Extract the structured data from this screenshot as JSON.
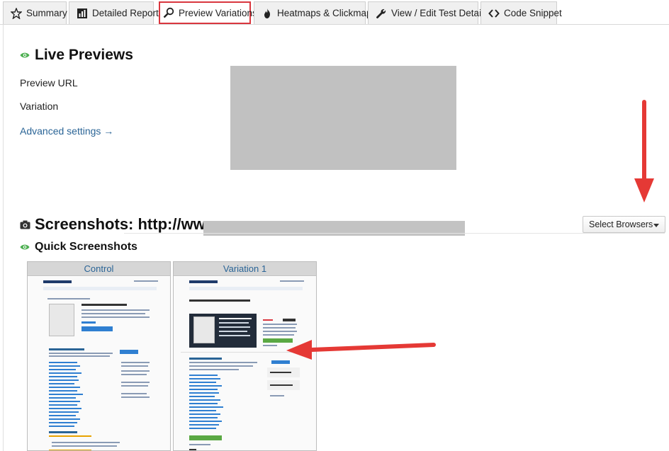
{
  "tabs": [
    {
      "label": "Summary",
      "icon": "star-icon",
      "active": false
    },
    {
      "label": "Detailed Report",
      "icon": "bar-chart-icon",
      "active": false
    },
    {
      "label": "Preview Variations",
      "icon": "magnifier-icon",
      "active": true
    },
    {
      "label": "Heatmaps & Clickmaps",
      "icon": "fire-icon",
      "active": false
    },
    {
      "label": "View / Edit Test Details",
      "icon": "wrench-icon",
      "active": false
    },
    {
      "label": "Code Snippet",
      "icon": "code-icon",
      "active": false
    }
  ],
  "live_previews": {
    "title": "Live Previews",
    "preview_url_label": "Preview URL",
    "variation_label": "Variation",
    "advanced_link": "Advanced settings →"
  },
  "screenshots": {
    "title": "Screenshots: http://www.",
    "quick_title": "Quick Screenshots",
    "select_browsers_label": "Select Browsers",
    "cards": [
      {
        "label": "Control"
      },
      {
        "label": "Variation 1"
      }
    ]
  },
  "colors": {
    "accent_red": "#d9363e",
    "link_blue": "#2a6496",
    "eye_green": "#4caf50",
    "annotation_arrow": "#e53935"
  }
}
